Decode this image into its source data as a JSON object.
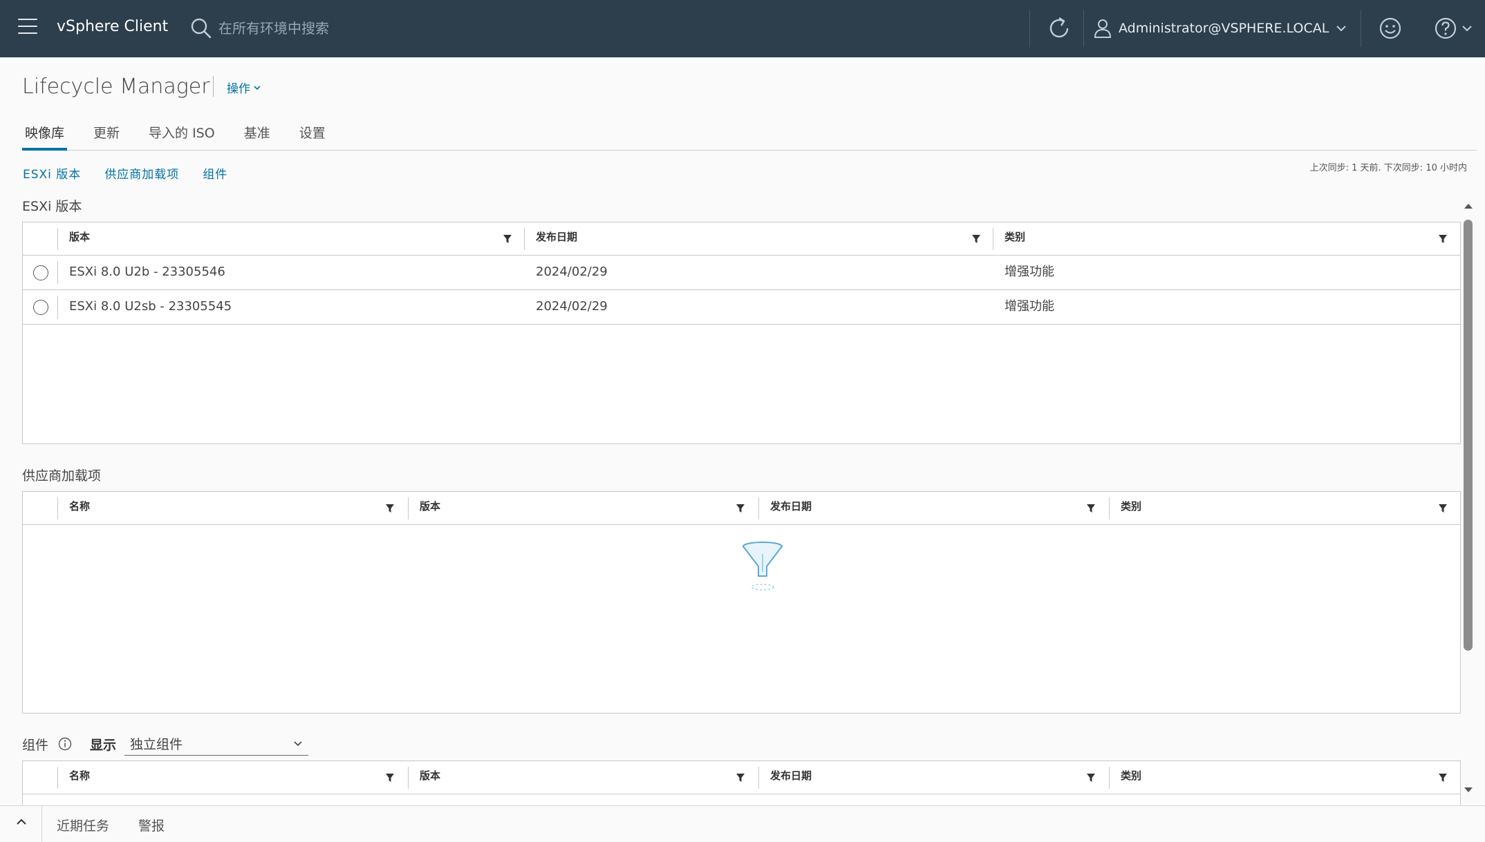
{
  "header": {
    "app_title": "vSphere Client",
    "search_placeholder": "在所有环境中搜索",
    "user": "Administrator@VSPHERE.LOCAL"
  },
  "page": {
    "title": "Lifecycle Manager",
    "actions_label": "操作"
  },
  "tabs": [
    {
      "label": "映像库",
      "active": true
    },
    {
      "label": "更新"
    },
    {
      "label": "导入的 ISO"
    },
    {
      "label": "基准"
    },
    {
      "label": "设置"
    }
  ],
  "sublinks": [
    "ESXi 版本",
    "供应商加载项",
    "组件"
  ],
  "sync_info": "上次同步: 1 天前. 下次同步: 10 小时内",
  "esxi": {
    "heading": "ESXi 版本",
    "columns": [
      "版本",
      "发布日期",
      "类别"
    ],
    "rows": [
      {
        "version": "ESXi 8.0 U2b - 23305546",
        "date": "2024/02/29",
        "category": "增强功能"
      },
      {
        "version": "ESXi 8.0 U2sb - 23305545",
        "date": "2024/02/29",
        "category": "增强功能"
      }
    ]
  },
  "vendor": {
    "heading": "供应商加载项",
    "columns": [
      "名称",
      "版本",
      "发布日期",
      "类别"
    ]
  },
  "components": {
    "heading": "组件",
    "show_label": "显示",
    "selected_view": "独立组件",
    "columns": [
      "名称",
      "版本",
      "发布日期",
      "类别"
    ]
  },
  "bottom_tabs": [
    "近期任务",
    "警报"
  ],
  "colors": {
    "header_bg": "#2d3e4c",
    "accent": "#0072a3"
  }
}
